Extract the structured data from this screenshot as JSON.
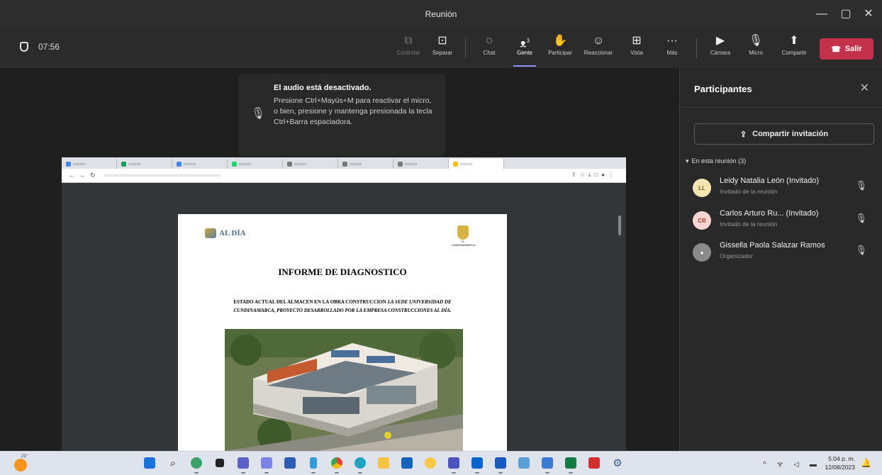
{
  "window": {
    "title": "Reunión",
    "minimize": "—",
    "maximize": "▢",
    "close": "✕"
  },
  "toolbar": {
    "timer": "07:56",
    "buttons": [
      {
        "icon": "control-icon",
        "glyph": "⧉",
        "label": "Controlar"
      },
      {
        "icon": "pop-out-icon",
        "glyph": "⊡",
        "label": "Separar"
      },
      {
        "icon": "chat-icon",
        "glyph": "◌",
        "label": "Chat"
      },
      {
        "icon": "people-icon",
        "glyph": "ᴥ",
        "label": "Gente",
        "count": "3"
      },
      {
        "icon": "raise-hand-icon",
        "glyph": "✋",
        "label": "Participar"
      },
      {
        "icon": "react-icon",
        "glyph": "☺",
        "label": "Reaccionar"
      },
      {
        "icon": "view-icon",
        "glyph": "⊞",
        "label": "Vista"
      },
      {
        "icon": "more-icon",
        "glyph": "···",
        "label": "Más"
      },
      {
        "icon": "camera-off-icon",
        "glyph": "▶",
        "label": "Cámara"
      },
      {
        "icon": "mic-off-icon",
        "glyph": "🎙",
        "label": "Micro"
      },
      {
        "icon": "share-icon",
        "glyph": "⬆",
        "label": "Compartir"
      }
    ],
    "leave_label": "Salir",
    "leave_color": "#c4314b",
    "accent": "#8b8cf5"
  },
  "toast": {
    "title": "El audio está desactivado.",
    "body": "Presione Ctrl+Mayús+M para reactivar el micro, o bien, presione y mantenga presionada la tecla Ctrl+Barra espaciadora."
  },
  "shared_screen": {
    "document": {
      "title": "INFORME DE DIAGNOSTICO",
      "subtitle_1": "ESTADO ACTUAL DEL ALMACEN EN LA OBRA CONSTRUCCION",
      "subtitle_1_italic": "LA SEDE UNIVERSIDAD DE CUNDINAMARCA, PROYECTO DESARROLLADO POR LA EMPRESA CONSTRUCCIONES AL DÍA.",
      "logo_text": "AL DÍA",
      "crest_caption": "U. CUNDINAMARCA"
    }
  },
  "panel": {
    "title": "Participantes",
    "share_invite": "Compartir invitación",
    "section": "En esta reunión (3)",
    "participants": [
      {
        "initials": "LL",
        "name": "Leidy Natalia León (Invitado)",
        "role": "Invitado de la reunión",
        "avatar_bg": "#f3e6b3",
        "avatar_fg": "#7a6420"
      },
      {
        "initials": "CR",
        "name": "Carlos Arturo Ru... (Invitado)",
        "role": "Invitado de la reunión",
        "avatar_bg": "#f6d6d2",
        "avatar_fg": "#a33a2e"
      },
      {
        "initials": "",
        "name": "Gissella Paola Salazar Ramos",
        "role": "Organizador",
        "avatar_bg": "#8a8a8a",
        "avatar_fg": "#ffffff"
      }
    ]
  },
  "taskbar": {
    "temperature": "21°",
    "time": "5:04 p. m.",
    "date": "12/08/2023"
  }
}
